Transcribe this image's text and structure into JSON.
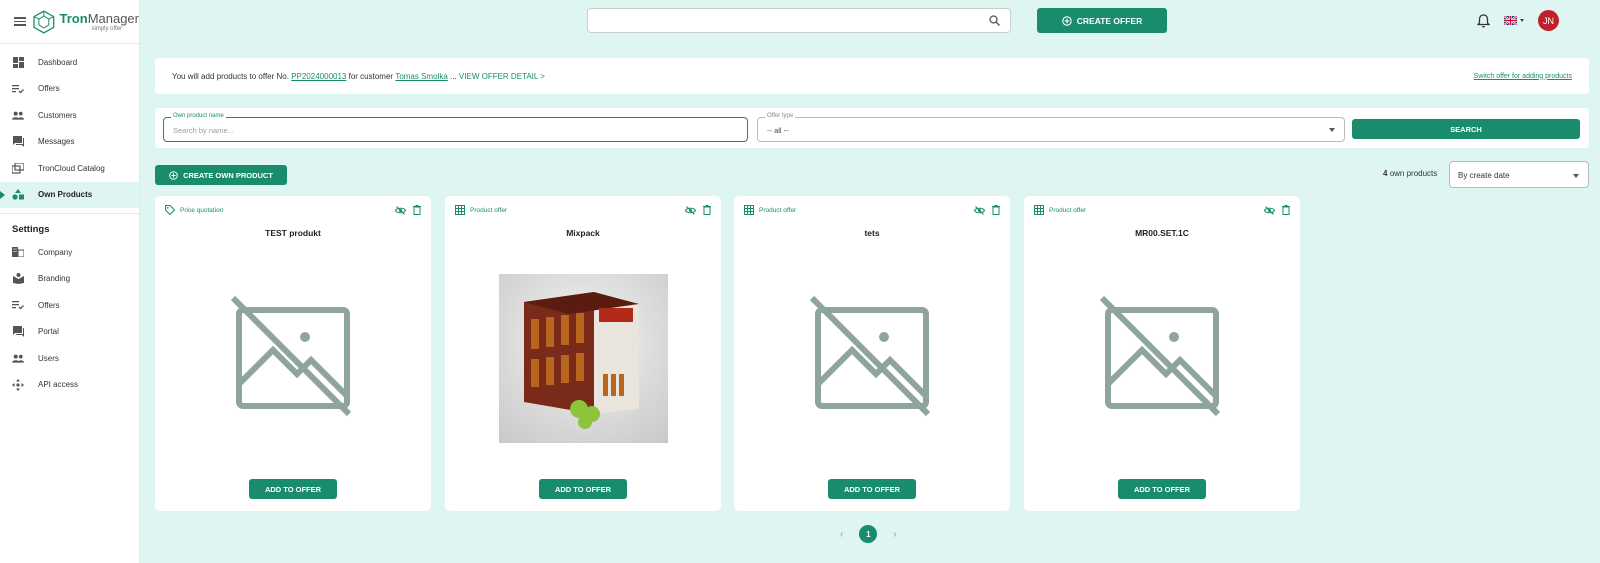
{
  "app": {
    "name_bold": "Tron",
    "name_rest": "Manager",
    "tagline": "simply offer"
  },
  "sidebar": {
    "items": [
      {
        "label": "Dashboard",
        "icon": "dashboard-icon"
      },
      {
        "label": "Offers",
        "icon": "offers-list-icon"
      },
      {
        "label": "Customers",
        "icon": "people-icon"
      },
      {
        "label": "Messages",
        "icon": "chat-icon"
      },
      {
        "label": "TronCloud Catalog",
        "icon": "catalog-icon"
      },
      {
        "label": "Own Products",
        "icon": "shapes-icon",
        "active": true
      }
    ],
    "settings_title": "Settings",
    "settings_items": [
      {
        "label": "Company",
        "icon": "company-icon"
      },
      {
        "label": "Branding",
        "icon": "branding-icon"
      },
      {
        "label": "Offers",
        "icon": "offers-list-icon"
      },
      {
        "label": "Portal",
        "icon": "portal-icon"
      },
      {
        "label": "Users",
        "icon": "people-icon"
      },
      {
        "label": "API access",
        "icon": "api-icon"
      }
    ]
  },
  "header": {
    "search_value": "",
    "create_offer_label": "CREATE OFFER",
    "avatar_initials": "JN",
    "language": "en-GB"
  },
  "info": {
    "prefix": "You will add products to offer No.",
    "offer_no": "PP2024000013",
    "middle": "for customer",
    "customer": "Tomas Smolka",
    "ellipsis": "...",
    "detail_link": "VIEW OFFER DETAIL >",
    "switch_link": "Switch offer for adding products"
  },
  "filters": {
    "name_label": "Own product name",
    "name_placeholder": "Search by name...",
    "type_label": "Offer type",
    "type_value": "-- all --",
    "search_label": "SEARCH"
  },
  "toolbar": {
    "create_own_label": "CREATE OWN PRODUCT",
    "count": "4",
    "count_suffix": "own products",
    "sort_value": "By create date"
  },
  "products": [
    {
      "type": "Price quotation",
      "name": "TEST produkt",
      "has_image": false,
      "add_label": "ADD TO OFFER"
    },
    {
      "type": "Product offer",
      "name": "Mixpack",
      "has_image": true,
      "add_label": "ADD TO OFFER"
    },
    {
      "type": "Product offer",
      "name": "tets",
      "has_image": false,
      "add_label": "ADD TO OFFER"
    },
    {
      "type": "Product offer",
      "name": "MR00.SET.1C",
      "has_image": false,
      "add_label": "ADD TO OFFER"
    }
  ],
  "pagination": {
    "current": "1",
    "prev": "‹",
    "next": "›"
  },
  "colors": {
    "accent": "#1a8c6e",
    "background": "#dff5f1",
    "avatar": "#c0202a"
  }
}
